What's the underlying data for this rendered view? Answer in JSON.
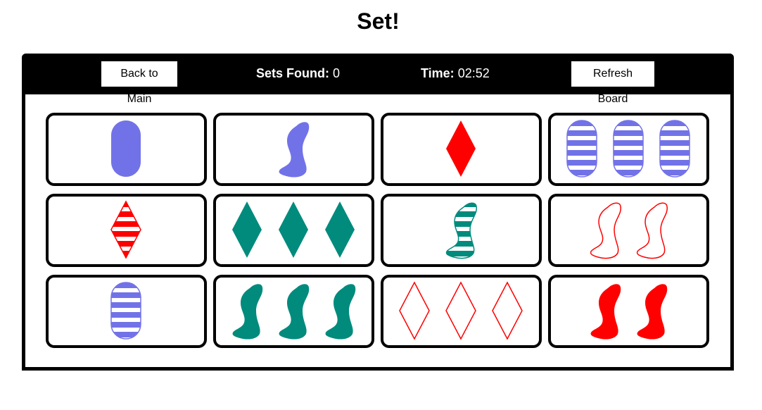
{
  "page": {
    "title": "Set!"
  },
  "header": {
    "back_label": "Back to Main",
    "sets_label": "Sets Found:",
    "sets_value": "0",
    "time_label": "Time:",
    "time_value": "02:52",
    "refresh_label": "Refresh Board"
  },
  "colors": {
    "purple": "#7272e8",
    "green": "#008b7d",
    "red": "#ff0000"
  },
  "cards": [
    {
      "count": 1,
      "shape": "oval",
      "color": "purple",
      "fill": "solid"
    },
    {
      "count": 1,
      "shape": "squiggle",
      "color": "purple",
      "fill": "solid"
    },
    {
      "count": 1,
      "shape": "diamond",
      "color": "red",
      "fill": "solid"
    },
    {
      "count": 3,
      "shape": "oval",
      "color": "purple",
      "fill": "striped"
    },
    {
      "count": 1,
      "shape": "diamond",
      "color": "red",
      "fill": "striped"
    },
    {
      "count": 3,
      "shape": "diamond",
      "color": "green",
      "fill": "solid"
    },
    {
      "count": 1,
      "shape": "squiggle",
      "color": "green",
      "fill": "striped"
    },
    {
      "count": 2,
      "shape": "squiggle",
      "color": "red",
      "fill": "open"
    },
    {
      "count": 1,
      "shape": "oval",
      "color": "purple",
      "fill": "striped"
    },
    {
      "count": 3,
      "shape": "squiggle",
      "color": "green",
      "fill": "solid"
    },
    {
      "count": 3,
      "shape": "diamond",
      "color": "red",
      "fill": "open"
    },
    {
      "count": 2,
      "shape": "squiggle",
      "color": "red",
      "fill": "solid"
    }
  ]
}
